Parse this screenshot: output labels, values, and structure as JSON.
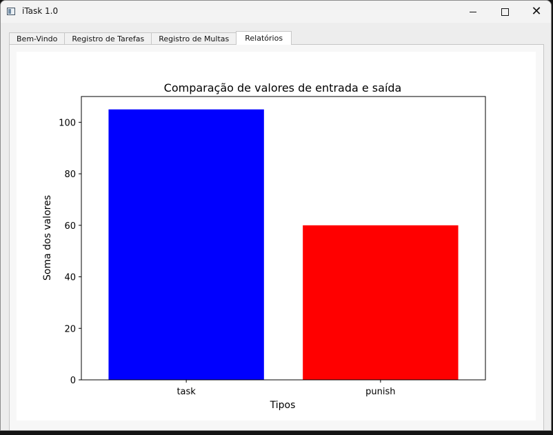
{
  "window": {
    "title": "iTask 1.0",
    "icon": "app-window-icon",
    "controls": [
      "minimize-icon",
      "maximize-icon",
      "close-icon"
    ]
  },
  "tabs": [
    {
      "label": "Bem-Vindo",
      "active": false
    },
    {
      "label": "Registro de Tarefas",
      "active": false
    },
    {
      "label": "Registro de Multas",
      "active": false
    },
    {
      "label": "Relatórios",
      "active": true
    }
  ],
  "chart_data": {
    "type": "bar",
    "title": "Comparação de valores de entrada e saída",
    "xlabel": "Tipos",
    "ylabel": "Soma dos valores",
    "categories": [
      "task",
      "punish"
    ],
    "values": [
      105,
      60
    ],
    "colors": [
      "#0000ff",
      "#ff0000"
    ],
    "ylim": [
      0,
      110
    ],
    "yticks": [
      0,
      20,
      40,
      60,
      80,
      100
    ],
    "grid": false,
    "legend": "none"
  }
}
